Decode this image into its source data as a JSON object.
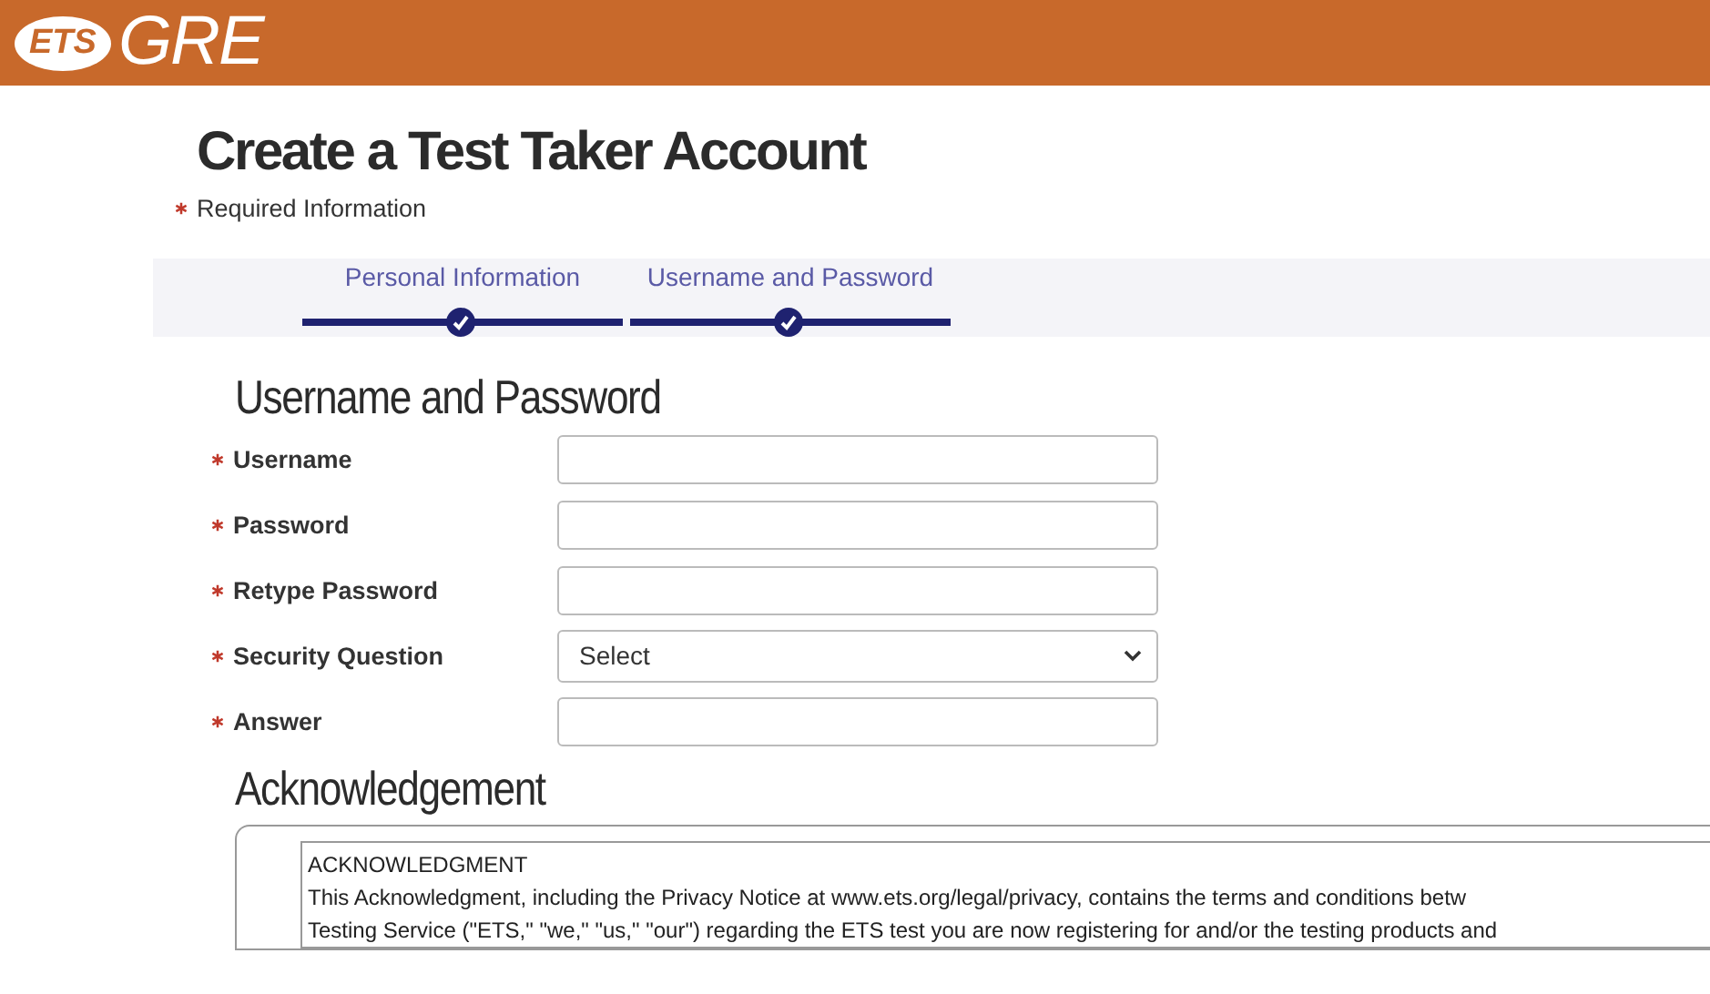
{
  "header": {
    "logo_mark": "ETS",
    "logo_text": "GRE"
  },
  "page_title": "Create a Test Taker Account",
  "required_note": "Required Information",
  "steps": [
    {
      "label": "Personal Information",
      "completed": true
    },
    {
      "label": "Username and Password",
      "completed": true
    }
  ],
  "section_title": "Username and Password",
  "fields": [
    {
      "label": "Username",
      "required": true,
      "kind": "text"
    },
    {
      "label": "Password",
      "required": true,
      "kind": "text"
    },
    {
      "label": "Retype Password",
      "required": true,
      "kind": "text"
    },
    {
      "label": "Security Question",
      "required": true,
      "kind": "select",
      "value": "Select"
    },
    {
      "label": "Answer",
      "required": true,
      "kind": "text"
    }
  ],
  "acknowledgement": {
    "title": "Acknowledgement",
    "lines": [
      "ACKNOWLEDGMENT",
      "This Acknowledgment, including the Privacy Notice at www.ets.org/legal/privacy, contains the terms and conditions betw",
      "Testing Service (\"ETS,\" \"we,\" \"us,\" \"our\") regarding the ETS test you are now registering for and/or the testing products and"
    ]
  }
}
